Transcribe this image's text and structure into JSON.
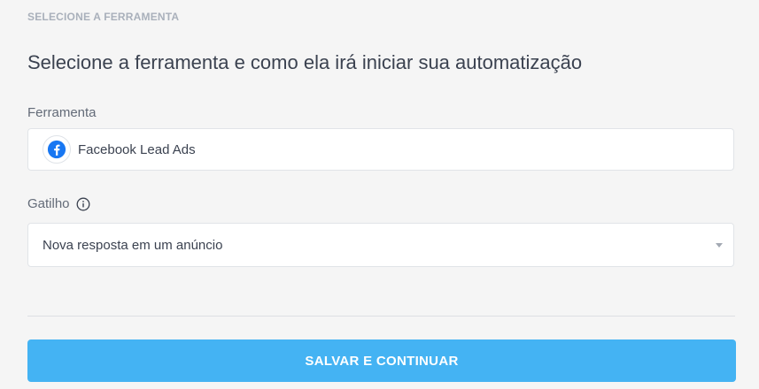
{
  "section": {
    "label": "SELECIONE A FERRAMENTA"
  },
  "page": {
    "title": "Selecione a ferramenta e como ela irá iniciar sua automatização"
  },
  "tool_field": {
    "label": "Ferramenta",
    "value": "Facebook Lead Ads",
    "icon": "facebook-icon",
    "icon_color": "#1877f2"
  },
  "trigger_field": {
    "label": "Gatilho",
    "info_icon": "info-icon",
    "value": "Nova resposta em um anúncio"
  },
  "actions": {
    "save_label": "SALVAR E CONTINUAR",
    "save_color": "#44b3f3"
  }
}
